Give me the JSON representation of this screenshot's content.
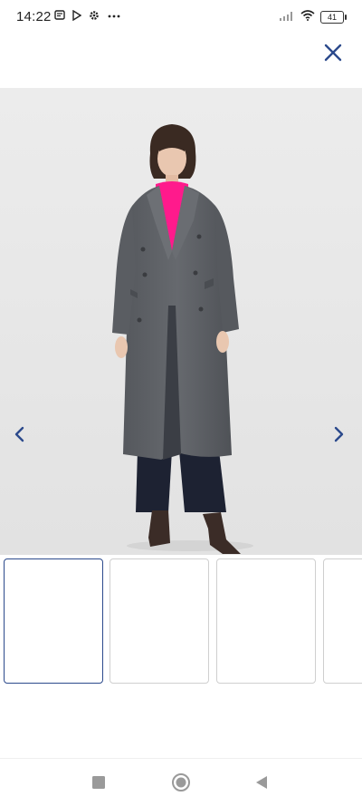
{
  "status_bar": {
    "time": "14:22",
    "left_icons": [
      "message-icon",
      "play-store-icon",
      "settings-gear-icon",
      "more-dots-icon"
    ],
    "signal_icon": "signal-icon",
    "wifi_icon": "wifi-icon",
    "battery_level": "41"
  },
  "header": {
    "close_icon": "close-icon"
  },
  "gallery": {
    "prev_icon": "chevron-left-icon",
    "next_icon": "chevron-right-icon",
    "selected_index": 0,
    "thumbnail_count": 4
  },
  "colors": {
    "accent": "#2c4a8c",
    "hero_background": "#e9e9e9",
    "coat": "#5e6166",
    "sweater": "#ff1a8c",
    "trousers": "#1d2232"
  },
  "system_nav": {
    "recents_icon": "square-recents-icon",
    "home_icon": "circle-home-icon",
    "back_icon": "triangle-back-icon"
  }
}
